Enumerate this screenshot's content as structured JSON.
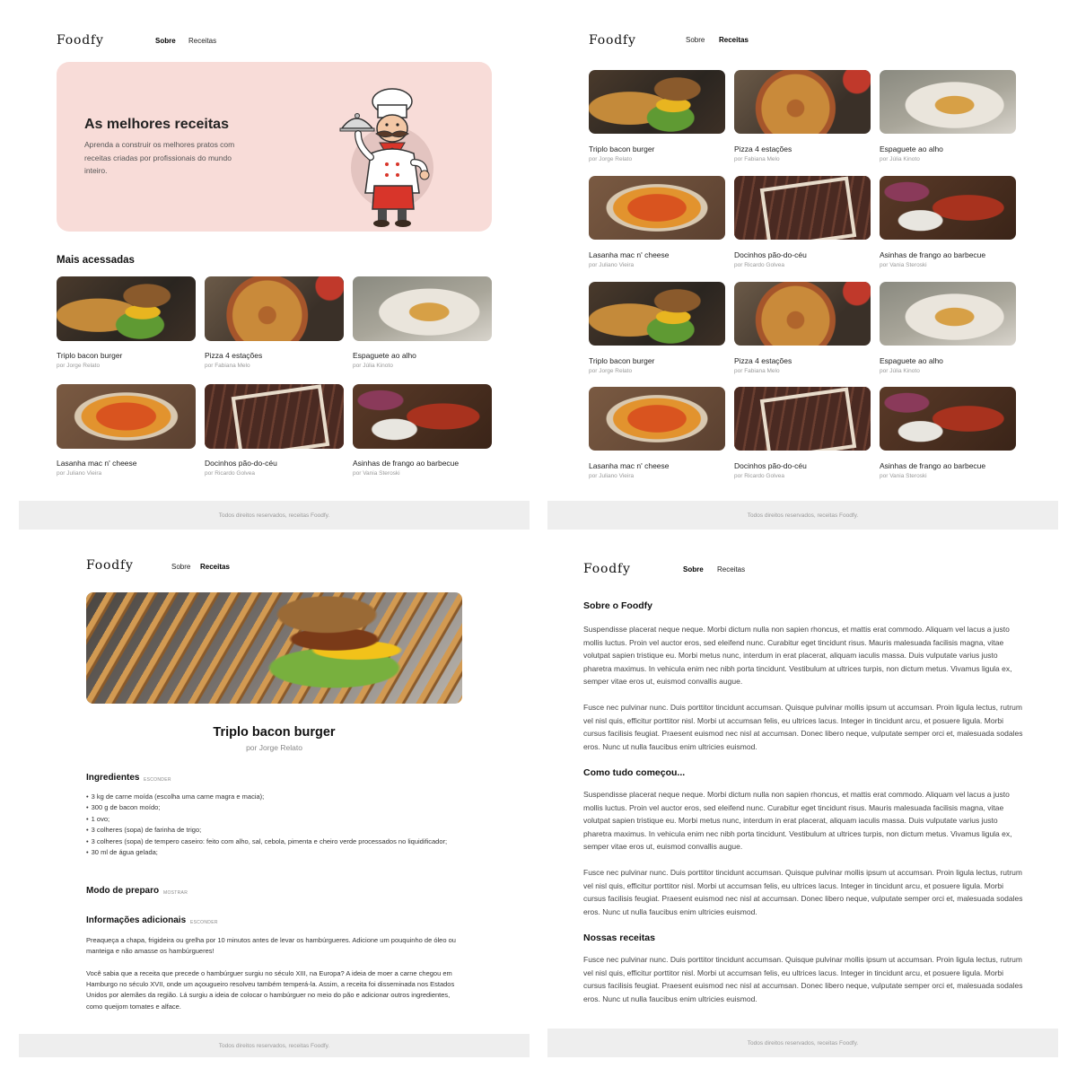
{
  "brand": "Foodfy",
  "nav": {
    "about": "Sobre",
    "recipes": "Receitas"
  },
  "footer": "Todos direitos reservados, receitas Foodfy.",
  "hero": {
    "title": "As melhores receitas",
    "text": "Aprenda a construir os melhores pratos com receitas criadas por profissionais do mundo inteiro."
  },
  "home": {
    "section_title": "Mais acessadas"
  },
  "recipes": [
    {
      "title": "Triplo bacon burger",
      "author": "por Jorge Relato",
      "image": "burger"
    },
    {
      "title": "Pizza 4 estações",
      "author": "por Fabiana Melo",
      "image": "pizza"
    },
    {
      "title": "Espaguete ao alho",
      "author": "por Júlia Kinoto",
      "image": "spaghetti"
    },
    {
      "title": "Lasanha mac n' cheese",
      "author": "por Juliano Vieira",
      "image": "lasagna"
    },
    {
      "title": "Docinhos pão-do-céu",
      "author": "por Ricardo Golvea",
      "image": "docinhos"
    },
    {
      "title": "Asinhas de frango ao barbecue",
      "author": "por Vania Steroski",
      "image": "wings"
    }
  ],
  "recipe_detail": {
    "title": "Triplo bacon burger",
    "author": "por Jorge Relato",
    "ingredients_title": "Ingredientes",
    "ingredients_toggle": "ESCONDER",
    "ingredients": [
      "3 kg de carne moída (escolha uma carne magra e macia);",
      "300 g de bacon moído;",
      "1 ovo;",
      "3 colheres (sopa) de farinha de trigo;",
      "3 colheres (sopa) de tempero caseiro: feito com alho, sal, cebola, pimenta e cheiro verde processados no liquidificador;",
      "30 ml de água gelada;"
    ],
    "preparation_title": "Modo de preparo",
    "preparation_toggle": "MOSTRAR",
    "info_title": "Informações adicionais",
    "info_toggle": "ESCONDER",
    "info_p1": "Preaqueça a chapa, frigideira ou grelha por 10 minutos antes de levar os hambúrgueres. Adicione um pouquinho de óleo ou manteiga e não amasse os hambúrgueres!",
    "info_p2": "Você sabia que a receita que precede o hambúrguer surgiu no século XIII, na Europa? A ideia de moer a carne chegou em Hamburgo no século XVII, onde um açougueiro resolveu também temperá-la. Assim, a receita foi disseminada nos Estados Unidos por alemães da região. Lá surgiu a ideia de colocar o hambúrguer no meio do pão e adicionar outros ingredientes, como queijom tomates e alface."
  },
  "about": {
    "title1": "Sobre o Foodfy",
    "p1": "Suspendisse placerat neque neque. Morbi dictum nulla non sapien rhoncus, et mattis erat commodo. Aliquam vel lacus a justo mollis luctus. Proin vel auctor eros, sed eleifend nunc. Curabitur eget tincidunt risus. Mauris malesuada facilisis magna, vitae volutpat sapien tristique eu. Morbi metus nunc, interdum in erat placerat, aliquam iaculis massa. Duis vulputate varius justo pharetra maximus. In vehicula enim nec nibh porta tincidunt. Vestibulum at ultrices turpis, non dictum metus. Vivamus ligula ex, semper vitae eros ut, euismod convallis augue.",
    "p2": "Fusce nec pulvinar nunc. Duis porttitor tincidunt accumsan. Quisque pulvinar mollis ipsum ut accumsan. Proin ligula lectus, rutrum vel nisl quis, efficitur porttitor nisl. Morbi ut accumsan felis, eu ultrices lacus. Integer in tincidunt arcu, et posuere ligula. Morbi cursus facilisis feugiat. Praesent euismod nec nisl at accumsan. Donec libero neque, vulputate semper orci et, malesuada sodales eros. Nunc ut nulla faucibus enim ultricies euismod.",
    "title2": "Como tudo começou...",
    "p3": "Suspendisse placerat neque neque. Morbi dictum nulla non sapien rhoncus, et mattis erat commodo. Aliquam vel lacus a justo mollis luctus. Proin vel auctor eros, sed eleifend nunc. Curabitur eget tincidunt risus. Mauris malesuada facilisis magna, vitae volutpat sapien tristique eu. Morbi metus nunc, interdum in erat placerat, aliquam iaculis massa. Duis vulputate varius justo pharetra maximus. In vehicula enim nec nibh porta tincidunt. Vestibulum at ultrices turpis, non dictum metus. Vivamus ligula ex, semper vitae eros ut, euismod convallis augue.",
    "p4": "Fusce nec pulvinar nunc. Duis porttitor tincidunt accumsan. Quisque pulvinar mollis ipsum ut accumsan. Proin ligula lectus, rutrum vel nisl quis, efficitur porttitor nisl. Morbi ut accumsan felis, eu ultrices lacus. Integer in tincidunt arcu, et posuere ligula. Morbi cursus facilisis feugiat. Praesent euismod nec nisl at accumsan. Donec libero neque, vulputate semper orci et, malesuada sodales eros. Nunc ut nulla faucibus enim ultricies euismod.",
    "title3": "Nossas receitas",
    "p5": "Fusce nec pulvinar nunc. Duis porttitor tincidunt accumsan. Quisque pulvinar mollis ipsum ut accumsan. Proin ligula lectus, rutrum vel nisl quis, efficitur porttitor nisl. Morbi ut accumsan felis, eu ultrices lacus. Integer in tincidunt arcu, et posuere ligula. Morbi cursus facilisis feugiat. Praesent euismod nec nisl at accumsan. Donec libero neque, vulputate semper orci et, malesuada sodales eros. Nunc ut nulla faucibus enim ultricies euismod."
  },
  "colors": {
    "hero_bg": "#f8dcd8",
    "footer_bg": "#eeeeee",
    "text": "#111111",
    "muted": "#999999"
  }
}
